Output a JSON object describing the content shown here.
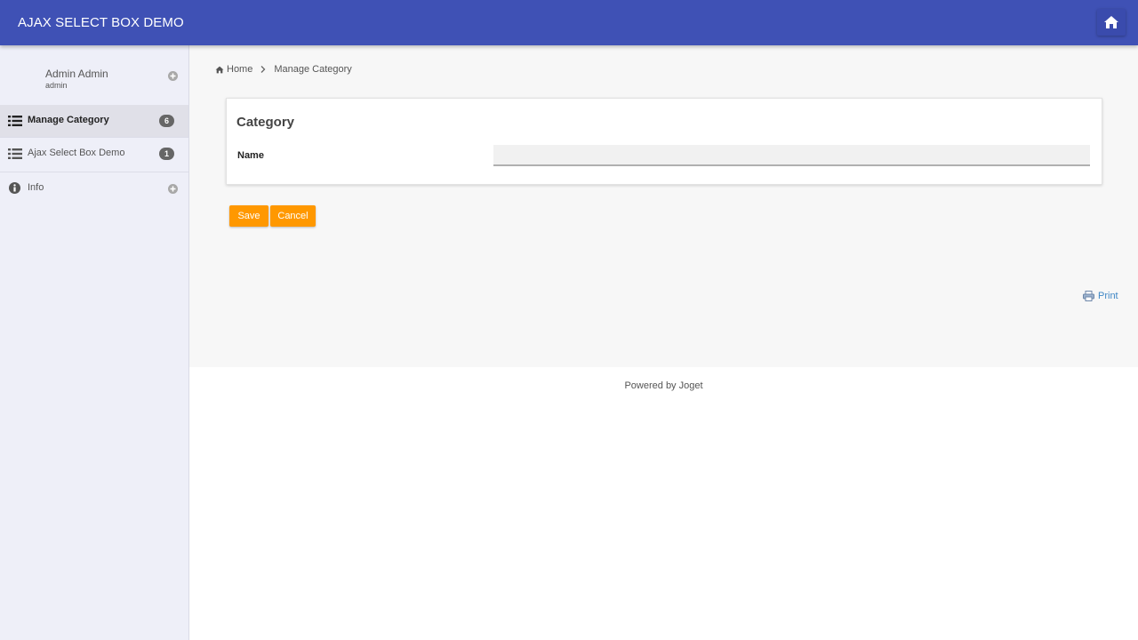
{
  "app": {
    "title": "AJAX SELECT BOX DEMO"
  },
  "user": {
    "name": "Admin Admin",
    "login": "admin"
  },
  "menu": [
    {
      "label": "Manage Category",
      "badge": "6",
      "active": true
    },
    {
      "label": "Ajax Select Box Demo",
      "badge": "1",
      "active": false
    },
    {
      "label": "Info"
    }
  ],
  "breadcrumb": {
    "home": "Home",
    "current": "Manage Category"
  },
  "form": {
    "title": "Category",
    "fields": [
      {
        "label": "Name",
        "value": ""
      }
    ],
    "save_label": "Save",
    "cancel_label": "Cancel"
  },
  "print_label": "Print",
  "footer": "Powered by Joget",
  "colors": {
    "header": "#3f51b5",
    "button": "#ff9800",
    "sidebar": "#eeeff8",
    "link": "#3f87c5"
  }
}
